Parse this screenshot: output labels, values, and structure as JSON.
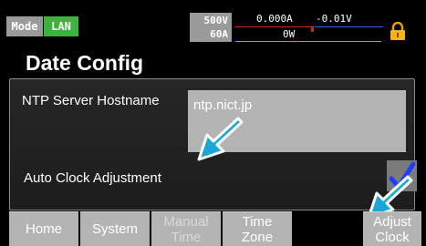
{
  "status_bar": {
    "mode_label": "Mode",
    "mode_value": "LAN",
    "voltage_limit": "500V",
    "current_limit": "60A",
    "current_reading": "0.000A",
    "voltage_reading": "-0.01V",
    "power_reading": "0W",
    "lock_icon": "padlock-icon"
  },
  "page": {
    "title": "Date Config"
  },
  "form": {
    "ntp_label": "NTP Server Hostname",
    "ntp_value": "ntp.nict.jp",
    "auto_adjust_label": "Auto Clock Adjustment",
    "auto_adjust_checked": true
  },
  "tabs": [
    {
      "label": "Home"
    },
    {
      "label": "System"
    },
    {
      "label": "Manual Time",
      "disabled": true
    },
    {
      "label": "Time Zone"
    },
    {
      "label": "Adjust Clock"
    }
  ],
  "colors": {
    "accent_green": "#3cb43c",
    "pointer_arrow": "#1aa6d6",
    "checkmark": "#1f3dff"
  }
}
